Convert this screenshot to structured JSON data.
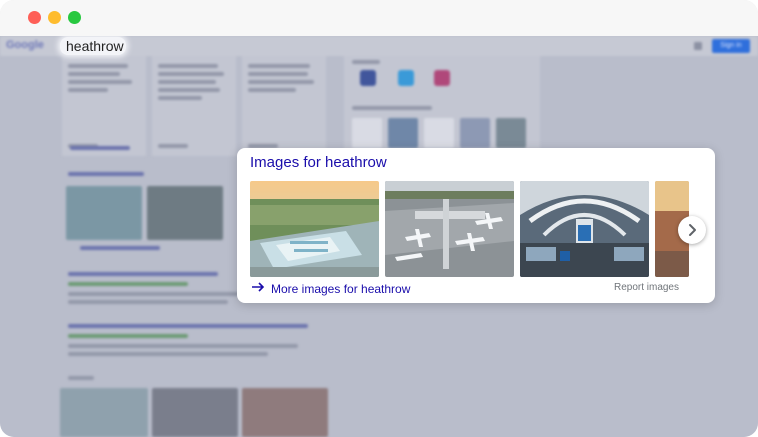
{
  "window": {
    "controls": [
      "close",
      "minimize",
      "zoom"
    ]
  },
  "search": {
    "logo": "Google",
    "query": "heathrow",
    "sign_in": "Sign in"
  },
  "card": {
    "title": "Images for heathrow",
    "images": [
      {
        "name": "heathrow-aerial-terminal-image"
      },
      {
        "name": "heathrow-aircraft-apron-image"
      },
      {
        "name": "heathrow-terminal-interior-image"
      },
      {
        "name": "heathrow-partial-image"
      }
    ],
    "more_link": "More images for heathrow",
    "report": "Report images",
    "next_icon": "chevron-right-icon"
  },
  "colors": {
    "link": "#1a0dab",
    "muted": "#70757a",
    "signin": "#2f6fdc"
  }
}
